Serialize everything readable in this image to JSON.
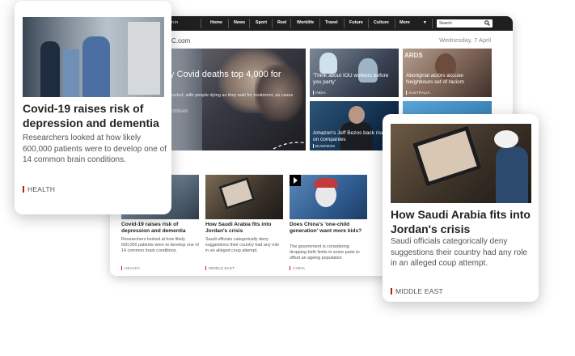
{
  "browser": {
    "nav": {
      "signin_label": "n in",
      "items": [
        "Home",
        "News",
        "Sport",
        "Reel",
        "Worklife",
        "Travel",
        "Future",
        "Culture",
        "More"
      ],
      "more_chevron": "▾",
      "search_placeholder": "Search"
    },
    "header": {
      "logo_fragment": "C.com",
      "date": "Wednesday, 7 April"
    },
    "hero": {
      "title": "y Covid deaths top 4,000 for",
      "summary": "owded, with people dying as they wait for treatment, as cases",
      "tag": "RIBBEAN"
    },
    "tiles": [
      {
        "title": "'Think about IOU workers before you party'",
        "tag": "INDIA"
      },
      {
        "title": "Aboriginal actors accuse Neighbours set of racism",
        "tag": "AUSTRALIA",
        "bg_text": "ARDS"
      },
      {
        "title": "Amazon's Jeff Bezos back rise on companies",
        "tag": "BUSINESS"
      }
    ],
    "cards": [
      {
        "title": "Covid-19 raises risk of depression and dementia",
        "summary": "Researchers looked at how likely 600,000 patients were to develop one of 14 common brain conditions.",
        "tag": "HEALTH"
      },
      {
        "title": "How Saudi Arabia fits into Jordan's crisis",
        "summary": "Saudi officials categorically deny suggestions their country had any role in an alleged coup attempt.",
        "tag": "MIDDLE EAST"
      },
      {
        "title": "Does China's 'one-child generation' want more kids?",
        "summary": "The government is considering dropping birth limits in some parts to offset an ageing population",
        "tag": "CHINA"
      }
    ]
  },
  "float_left": {
    "title": "Covid-19 raises risk of depression and dementia",
    "summary": "Researchers looked at how likely 600,000 patients were to develop one of 14 common brain conditions.",
    "tag": "HEALTH"
  },
  "float_right": {
    "title": "How Saudi Arabia fits into Jordan's crisis",
    "summary": "Saudi officials categorically deny suggestions their country had any role in an alleged coup attempt.",
    "tag": "MIDDLE EAST"
  },
  "colors": {
    "nav_bg": "#1f1f1f",
    "accent_red": "#bb1919"
  }
}
